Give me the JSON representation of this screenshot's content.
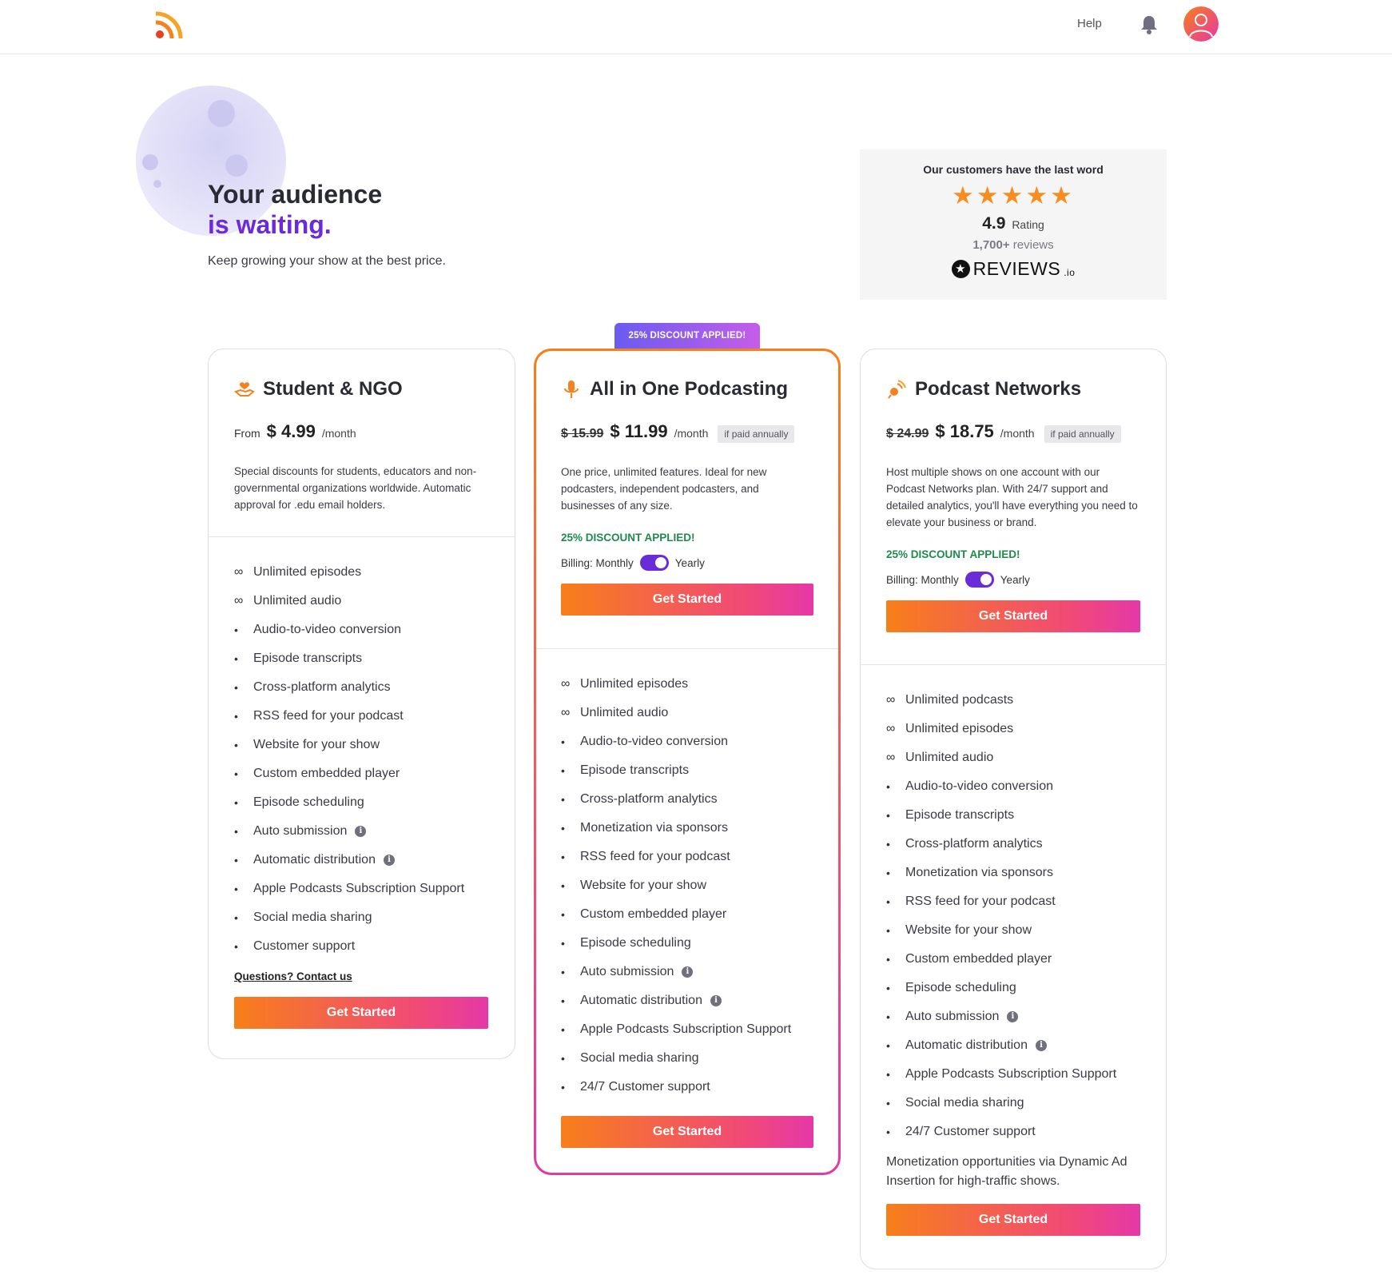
{
  "header": {
    "help_label": "Help"
  },
  "hero": {
    "title_line1": "Your audience",
    "title_line2": "is waiting.",
    "subtitle": "Keep growing your show at the best price."
  },
  "reviews": {
    "heading": "Our customers have the last word",
    "stars": "★★★★★",
    "rating_value": "4.9",
    "rating_label": "Rating",
    "review_count": "1,700+",
    "review_label": "reviews",
    "brand_name": "REVIEWS",
    "brand_suffix": ".io"
  },
  "featured_badge": "25% DISCOUNT APPLIED!",
  "colors": {
    "accent_purple": "#6a2bd9",
    "gradient_orange": "#f77f1a",
    "gradient_pink": "#e538a8",
    "discount_green": "#1f8a4c",
    "star_orange": "#f78d1e"
  },
  "plans": [
    {
      "title": "Student & NGO",
      "icon": "hand-heart-icon",
      "from_label": "From",
      "price": "$ 4.99",
      "period": "/month",
      "description": "Special discounts for students, educators and non-governmental organizations worldwide. Automatic approval for .edu email holders.",
      "features": [
        "Unlimited episodes",
        "Unlimited audio",
        "Audio-to-video conversion",
        "Episode transcripts",
        "Cross-platform analytics",
        "RSS feed for your podcast",
        "Website for your show",
        "Custom embedded player",
        "Episode scheduling",
        "Auto submission",
        "Automatic distribution",
        "Apple Podcasts Subscription Support",
        "Social media sharing",
        "Customer support"
      ],
      "contact_label": "Questions? Contact us",
      "cta_label": "Get Started"
    },
    {
      "title": "All in One Podcasting",
      "icon": "microphone-icon",
      "old_price": "$ 15.99",
      "price": "$ 11.99",
      "period": "/month",
      "paid_note": "if paid annually",
      "description": "One price, unlimited features. Ideal for new podcasters, independent podcasters, and businesses of any size.",
      "discount_label": "25% DISCOUNT APPLIED!",
      "billing_label": "Billing: Monthly",
      "billing_option": "Yearly",
      "billing_yearly": true,
      "cta_label": "Get Started",
      "features": [
        "Unlimited episodes",
        "Unlimited audio",
        "Audio-to-video conversion",
        "Episode transcripts",
        "Cross-platform analytics",
        "Monetization via sponsors",
        "RSS feed for your podcast",
        "Website for your show",
        "Custom embedded player",
        "Episode scheduling",
        "Auto submission",
        "Automatic distribution",
        "Apple Podcasts Subscription Support",
        "Social media sharing",
        "24/7 Customer support"
      ],
      "cta_bottom_label": "Get Started"
    },
    {
      "title": "Podcast Networks",
      "icon": "broadcast-icon",
      "old_price": "$ 24.99",
      "price": "$ 18.75",
      "period": "/month",
      "paid_note": "if paid annually",
      "description": "Host multiple shows on one account with our Podcast Networks plan. With 24/7 support and detailed analytics, you'll have everything you need to elevate your business or brand.",
      "discount_label": "25% DISCOUNT APPLIED!",
      "billing_label": "Billing: Monthly",
      "billing_option": "Yearly",
      "billing_yearly": true,
      "cta_label": "Get Started",
      "features": [
        "Unlimited podcasts",
        "Unlimited episodes",
        "Unlimited audio",
        "Audio-to-video conversion",
        "Episode transcripts",
        "Cross-platform analytics",
        "Monetization via sponsors",
        "RSS feed for your podcast",
        "Website for your show",
        "Custom embedded player",
        "Episode scheduling",
        "Auto submission",
        "Automatic distribution",
        "Apple Podcasts Subscription Support",
        "Social media sharing",
        "24/7 Customer support"
      ],
      "extra_note": "Monetization opportunities via Dynamic Ad Insertion for high-traffic shows.",
      "cta_bottom_label": "Get Started"
    }
  ]
}
